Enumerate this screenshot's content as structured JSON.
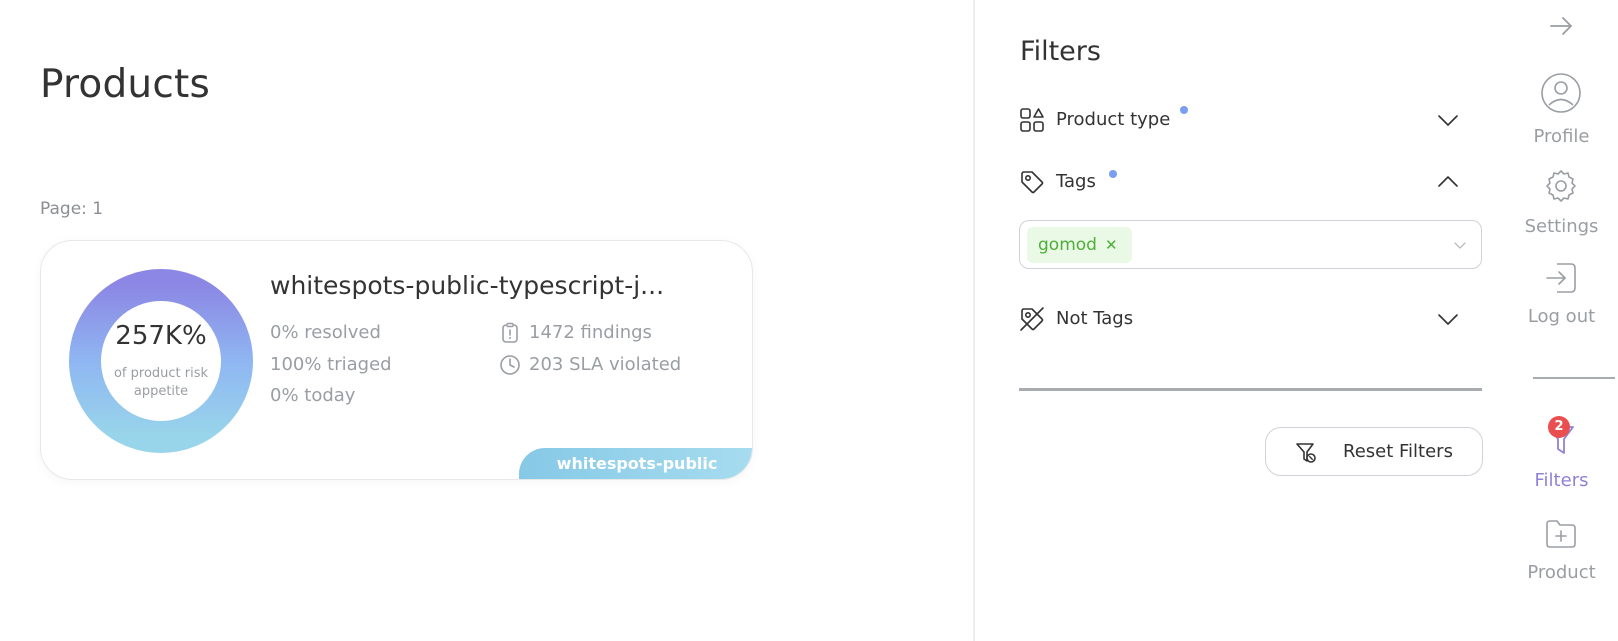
{
  "main": {
    "title": "Products",
    "page_indicator": "Page: 1"
  },
  "product_card": {
    "risk_value": "257K%",
    "risk_caption": "of product risk appetite",
    "title": "whitespots-public-typescript-j...",
    "resolved": "0% resolved",
    "triaged": "100% triaged",
    "today": "0% today",
    "findings": "1472 findings",
    "sla_violated": "203 SLA violated",
    "group_badge": "whitespots-public",
    "donut_colors": [
      "#8c87e4",
      "#8fb6f2",
      "#98d5ea"
    ]
  },
  "filters": {
    "title": "Filters",
    "product_type_label": "Product type",
    "tags_label": "Tags",
    "selected_tag": "gomod",
    "not_tags_label": "Not Tags",
    "reset_label": "Reset Filters",
    "accent_dot_color": "#7b9df2"
  },
  "sidebar": {
    "profile_label": "Profile",
    "settings_label": "Settings",
    "logout_label": "Log out",
    "filters_label": "Filters",
    "filters_count": "2",
    "product_label": "Product"
  }
}
